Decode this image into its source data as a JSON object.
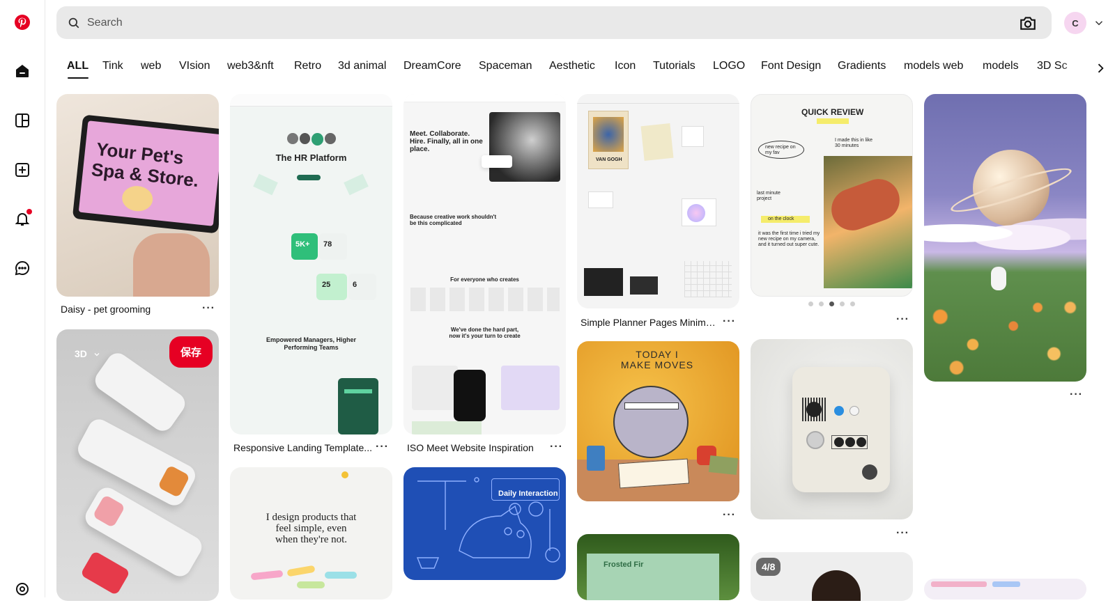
{
  "search": {
    "placeholder": "Search"
  },
  "account": {
    "initial": "C"
  },
  "tabs": [
    "ALL",
    "Tink",
    "web",
    "VIsion",
    "web3&nft",
    "Retro",
    "3d animal",
    "DreamCore",
    "Spaceman",
    "Aesthetic",
    "Icon",
    "Tutorials",
    "LOGO",
    "Font Design",
    "Gradients",
    "models web",
    "models",
    "3D Sc"
  ],
  "active_tab": "ALL",
  "pins": {
    "daisy": {
      "title": "Daisy - pet grooming",
      "image_text_1": "Your Pet's",
      "image_text_2": "Spa & Store."
    },
    "device3d": {
      "board_label": "3D",
      "save_label": "保存"
    },
    "hr": {
      "title": "Responsive Landing Template...",
      "headline": "The HR Platform",
      "stat1": "5K+",
      "stat2": "78",
      "stat3": "25",
      "stat4": "6",
      "sub": "Empowered Managers, Higher Performing Teams"
    },
    "meet": {
      "title": "ISO Meet Website Inspiration",
      "headline": "Meet. Collaborate. Hire. Finally, all in one place.",
      "section1": "Because creative work shouldn't be this complicated",
      "section2": "For everyone who creates",
      "section3": "We've done the hard part, now it's your turn to create"
    },
    "planner": {
      "title": "Simple Planner Pages Minimal...",
      "vangogh": "VAN GOGH"
    },
    "review": {
      "heading": "QUICK REVIEW",
      "note1": "new recipe on my fav",
      "note2": "I made this in like 30 minutes",
      "note3": "last minute project",
      "note4": "on the clock",
      "body": "it was the first time i tried my new recipe on my camera, and it turned out super cute."
    },
    "today": {
      "text": "TODAY I MAKE MOVES"
    },
    "designer": {
      "text": "I design products that feel simple, even when they're not."
    },
    "cat": {
      "label": "Daily Interaction"
    },
    "frosted": {
      "label": "Frosted Fir"
    },
    "portrait": {
      "badge": "4/8"
    }
  },
  "icons": {
    "logo": "pinterest-logo-icon",
    "home": "home-icon",
    "explore": "explore-icon",
    "create": "create-icon",
    "notifications": "bell-icon",
    "messages": "chat-icon",
    "camera": "camera-icon",
    "search": "search-icon"
  },
  "colors": {
    "brand": "#e60023",
    "search_bg": "#e9e9e9",
    "avatar_bg": "#f6d6f0"
  }
}
